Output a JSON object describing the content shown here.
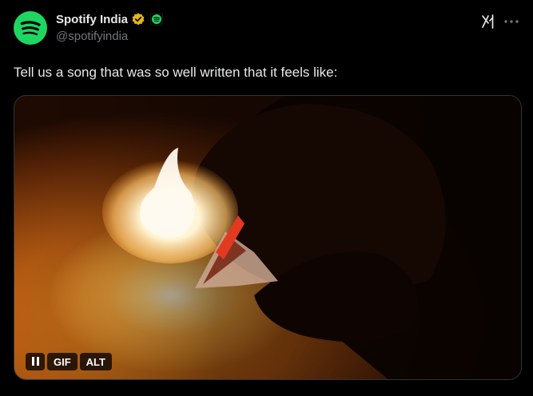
{
  "tweet": {
    "author": {
      "display_name": "Spotify India",
      "handle": "@spotifyindia",
      "verified_badge_color": "#e2b719",
      "affiliation_badge_color": "#1ed760",
      "avatar_color": "#1ed760"
    },
    "text": "Tell us a song that was so well written that it feels like:",
    "media": {
      "type": "gif",
      "controls": {
        "pause_icon": "pause-icon",
        "gif_label": "GIF",
        "alt_label": "ALT"
      }
    }
  },
  "header_icons": [
    "grok-icon",
    "more-icon"
  ]
}
